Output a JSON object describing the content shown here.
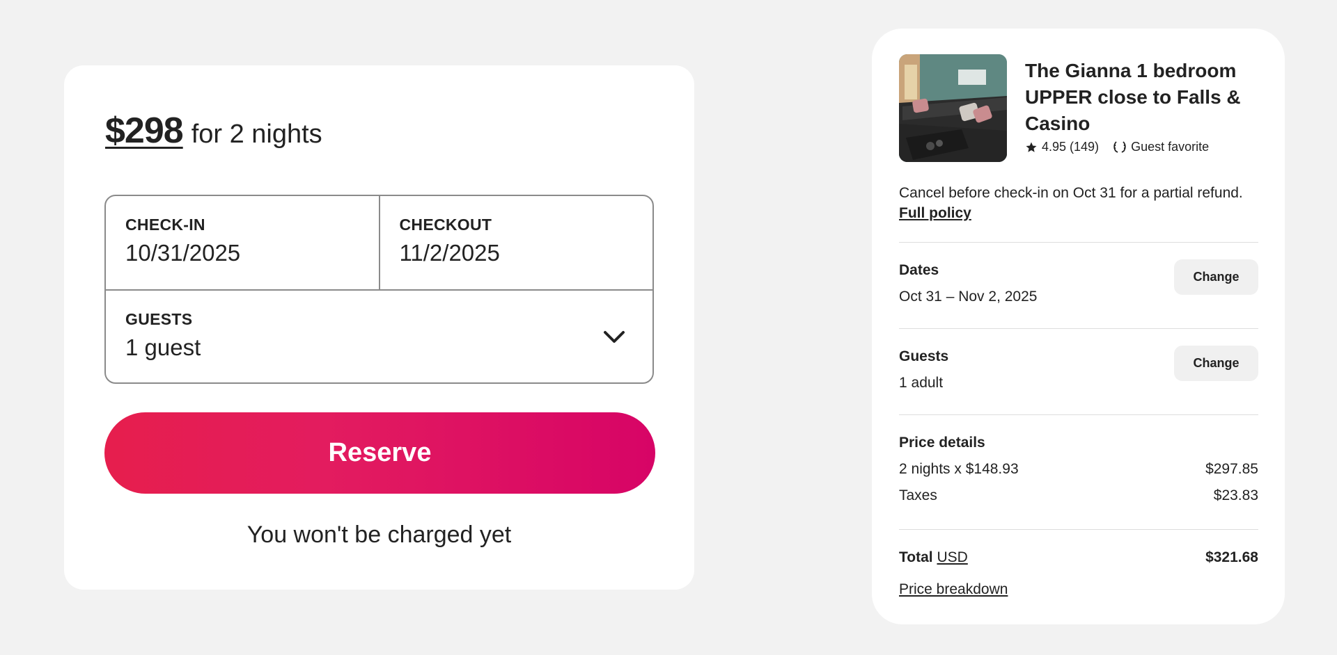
{
  "booking": {
    "price": "$298",
    "price_suffix": "for 2 nights",
    "checkin_label": "CHECK-IN",
    "checkin_value": "10/31/2025",
    "checkout_label": "CHECKOUT",
    "checkout_value": "11/2/2025",
    "guests_label": "GUESTS",
    "guests_value": "1 guest",
    "reserve_label": "Reserve",
    "charge_note": "You won't be charged yet"
  },
  "summary": {
    "title": "The Gianna 1 bedroom UPPER close to Falls & Casino",
    "rating": "4.95 (149)",
    "badge": "Guest favorite",
    "cancel_text": "Cancel before check-in on Oct 31 for a partial refund.",
    "cancel_link": "Full policy",
    "dates_title": "Dates",
    "dates_value": "Oct 31 – Nov 2, 2025",
    "dates_change": "Change",
    "guests_title": "Guests",
    "guests_value": "1 adult",
    "guests_change": "Change",
    "price_title": "Price details",
    "line_items": [
      {
        "label": "2 nights x $148.93",
        "amount": "$297.85"
      },
      {
        "label": "Taxes",
        "amount": "$23.83"
      }
    ],
    "total_label": "Total",
    "currency": "USD",
    "total_amount": "$321.68",
    "breakdown_link": "Price breakdown"
  },
  "colors": {
    "accent_start": "#e61e4d",
    "accent_end": "#d70466",
    "text": "#222222",
    "background": "#f2f2f2"
  },
  "icons": [
    "chevron-down-icon",
    "star-icon",
    "laurel-icon"
  ]
}
